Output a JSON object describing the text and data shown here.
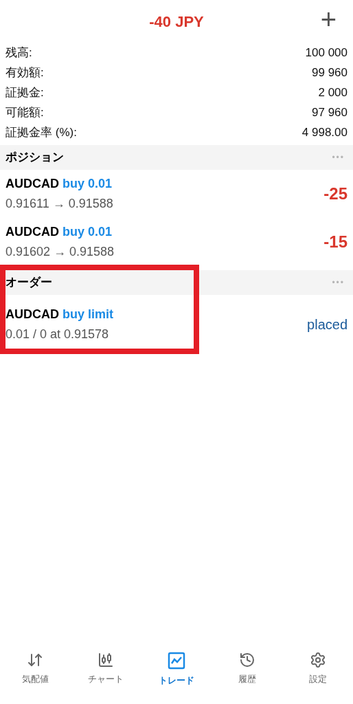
{
  "header": {
    "title": "-40 JPY",
    "add_icon": "+"
  },
  "summary": [
    {
      "label": "残高:",
      "value": "100 000"
    },
    {
      "label": "有効額:",
      "value": "99 960"
    },
    {
      "label": "証拠金:",
      "value": "2 000"
    },
    {
      "label": "可能額:",
      "value": "97 960"
    },
    {
      "label": "証拠金率 (%):",
      "value": "4 998.00"
    }
  ],
  "positions": {
    "title": "ポジション",
    "more": "•••",
    "items": [
      {
        "symbol": "AUDCAD",
        "action": "buy 0.01",
        "prices": "0.91611 → 0.91588",
        "profit": "-25"
      },
      {
        "symbol": "AUDCAD",
        "action": "buy 0.01",
        "prices": "0.91602 → 0.91588",
        "profit": "-15"
      }
    ]
  },
  "orders": {
    "title": "オーダー",
    "more": "•••",
    "highlighted": true,
    "items": [
      {
        "symbol": "AUDCAD",
        "action": "buy limit",
        "details": "0.01 / 0 at 0.91578",
        "status": "placed"
      }
    ]
  },
  "tabs": [
    {
      "label": "気配値",
      "kind": "quotes",
      "selected": false
    },
    {
      "label": "チャート",
      "kind": "chart",
      "selected": false
    },
    {
      "label": "トレード",
      "kind": "trade",
      "selected": true
    },
    {
      "label": "履歴",
      "kind": "history",
      "selected": false
    },
    {
      "label": "設定",
      "kind": "settings",
      "selected": false
    }
  ]
}
